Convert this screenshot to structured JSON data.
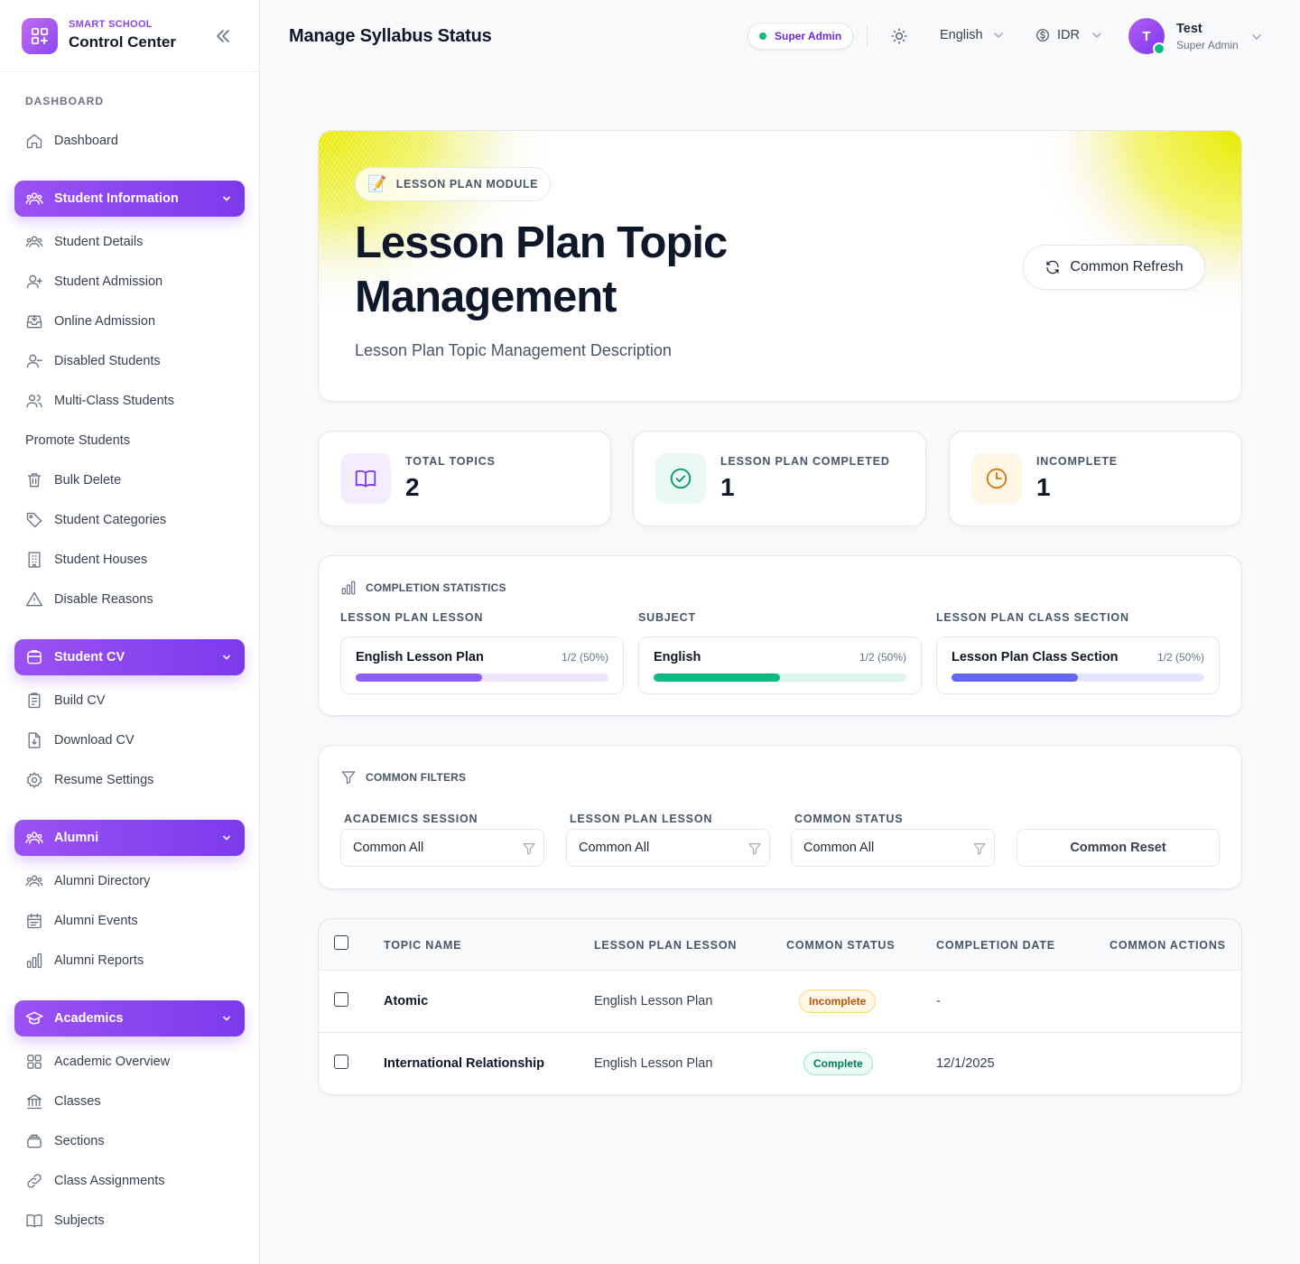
{
  "brand": {
    "subtitle": "SMART SCHOOL",
    "title": "Control Center"
  },
  "sidebar": {
    "heading": "DASHBOARD",
    "dashboard": "Dashboard",
    "groups": {
      "student_information": {
        "label": "Student Information",
        "items": [
          "Student Details",
          "Student Admission",
          "Online Admission",
          "Disabled Students",
          "Multi-Class Students",
          "Promote Students",
          "Bulk Delete",
          "Student Categories",
          "Student Houses",
          "Disable Reasons"
        ]
      },
      "student_cv": {
        "label": "Student CV",
        "items": [
          "Build CV",
          "Download CV",
          "Resume Settings"
        ]
      },
      "alumni": {
        "label": "Alumni",
        "items": [
          "Alumni Directory",
          "Alumni Events",
          "Alumni Reports"
        ]
      },
      "academics": {
        "label": "Academics",
        "items": [
          "Academic Overview",
          "Classes",
          "Sections",
          "Class Assignments",
          "Subjects"
        ]
      }
    }
  },
  "header": {
    "title": "Manage Syllabus Status",
    "role_badge": "Super Admin",
    "language": "English",
    "currency": "IDR",
    "user": {
      "initial": "T",
      "name": "Test",
      "role": "Super Admin"
    }
  },
  "hero": {
    "module_emoji": "📝",
    "module_label": "LESSON PLAN MODULE",
    "title": "Lesson Plan Topic Management",
    "description": "Lesson Plan Topic Management Description",
    "refresh_label": "Common Refresh"
  },
  "stats": [
    {
      "label": "TOTAL TOPICS",
      "value": "2"
    },
    {
      "label": "LESSON PLAN COMPLETED",
      "value": "1"
    },
    {
      "label": "INCOMPLETE",
      "value": "1"
    }
  ],
  "completion": {
    "heading": "COMPLETION STATISTICS",
    "columns": [
      {
        "label": "LESSON PLAN LESSON",
        "name": "English Lesson Plan",
        "ratio": "1/2 (50%)",
        "progress": 0.5,
        "fill": "#8b5cf6",
        "track": "#ede5fd"
      },
      {
        "label": "SUBJECT",
        "name": "English",
        "ratio": "1/2 (50%)",
        "progress": 0.5,
        "fill": "#10b981",
        "track": "#dcf5ec"
      },
      {
        "label": "LESSON PLAN CLASS SECTION",
        "name": "Lesson Plan Class Section",
        "ratio": "1/2 (50%)",
        "progress": 0.5,
        "fill": "#6366f1",
        "track": "#e4e6fd"
      }
    ]
  },
  "filters": {
    "heading": "COMMON FILTERS",
    "fields": [
      {
        "label": "ACADEMICS SESSION",
        "value": "Common All"
      },
      {
        "label": "LESSON PLAN LESSON",
        "value": "Common All"
      },
      {
        "label": "COMMON STATUS",
        "value": "Common All"
      }
    ],
    "reset_label": "Common Reset"
  },
  "table": {
    "headers": [
      "TOPIC NAME",
      "LESSON PLAN LESSON",
      "COMMON STATUS",
      "COMPLETION DATE",
      "COMMON ACTIONS"
    ],
    "rows": [
      {
        "topic": "Atomic",
        "lesson": "English Lesson Plan",
        "status": "Incomplete",
        "date": "-"
      },
      {
        "topic": "International Relationship",
        "lesson": "English Lesson Plan",
        "status": "Complete",
        "date": "12/1/2025"
      }
    ]
  },
  "colors": {
    "accent": "#7c3aed",
    "success": "#10b981",
    "warning": "#d97706"
  }
}
